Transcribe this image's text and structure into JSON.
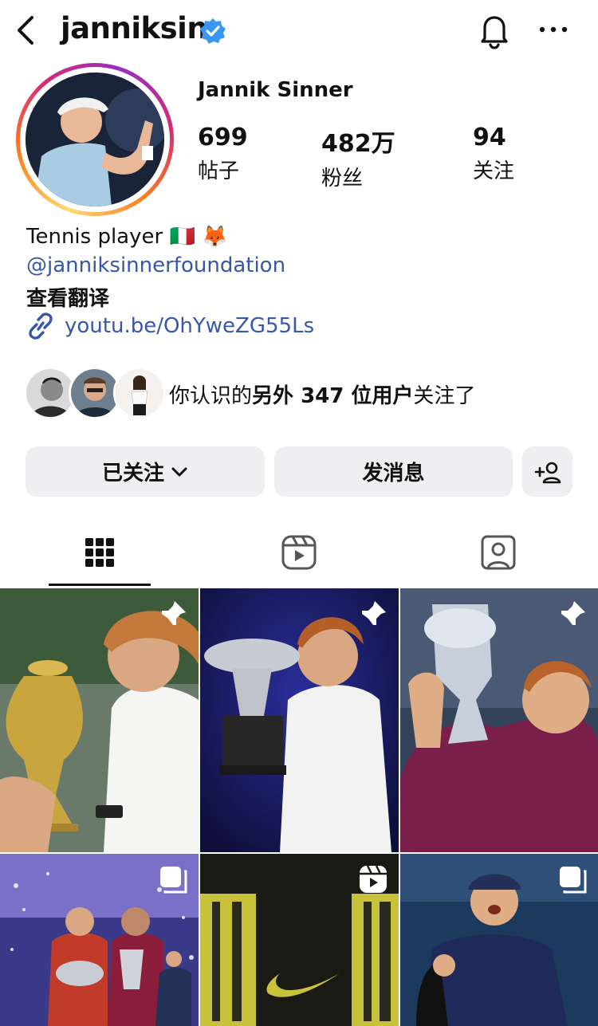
{
  "header": {
    "username": "janniksin"
  },
  "profile": {
    "full_name": "Jannik Sinner",
    "stats": [
      {
        "value": "699",
        "label": "帖子"
      },
      {
        "value": "482万",
        "label": "粉丝"
      },
      {
        "value": "94",
        "label": "关注"
      }
    ],
    "bio_text": "Tennis player 🇮🇹 🦊",
    "bio_mention": "@janniksinnerfoundation",
    "translate_label": "查看翻译",
    "link": "youtu.be/OhYweZG55Ls"
  },
  "mutual": {
    "prefix": "你认识的",
    "emphasis": "另外 347 位用户",
    "suffix": "关注了"
  },
  "actions": {
    "following_label": "已关注",
    "message_label": "发消息"
  },
  "tabs": [
    {
      "icon": "grid-icon",
      "active": true
    },
    {
      "icon": "reels-icon",
      "active": false
    },
    {
      "icon": "tagged-icon",
      "active": false
    }
  ],
  "posts": [
    {
      "badge": "pin-icon"
    },
    {
      "badge": "pin-icon"
    },
    {
      "badge": "pin-icon"
    },
    {
      "badge": "carousel-icon"
    },
    {
      "badge": "reel-icon"
    },
    {
      "badge": "carousel-icon"
    }
  ],
  "colors": {
    "link": "#3757a8",
    "verified": "#3897f0",
    "button_bg": "#efeff1"
  }
}
